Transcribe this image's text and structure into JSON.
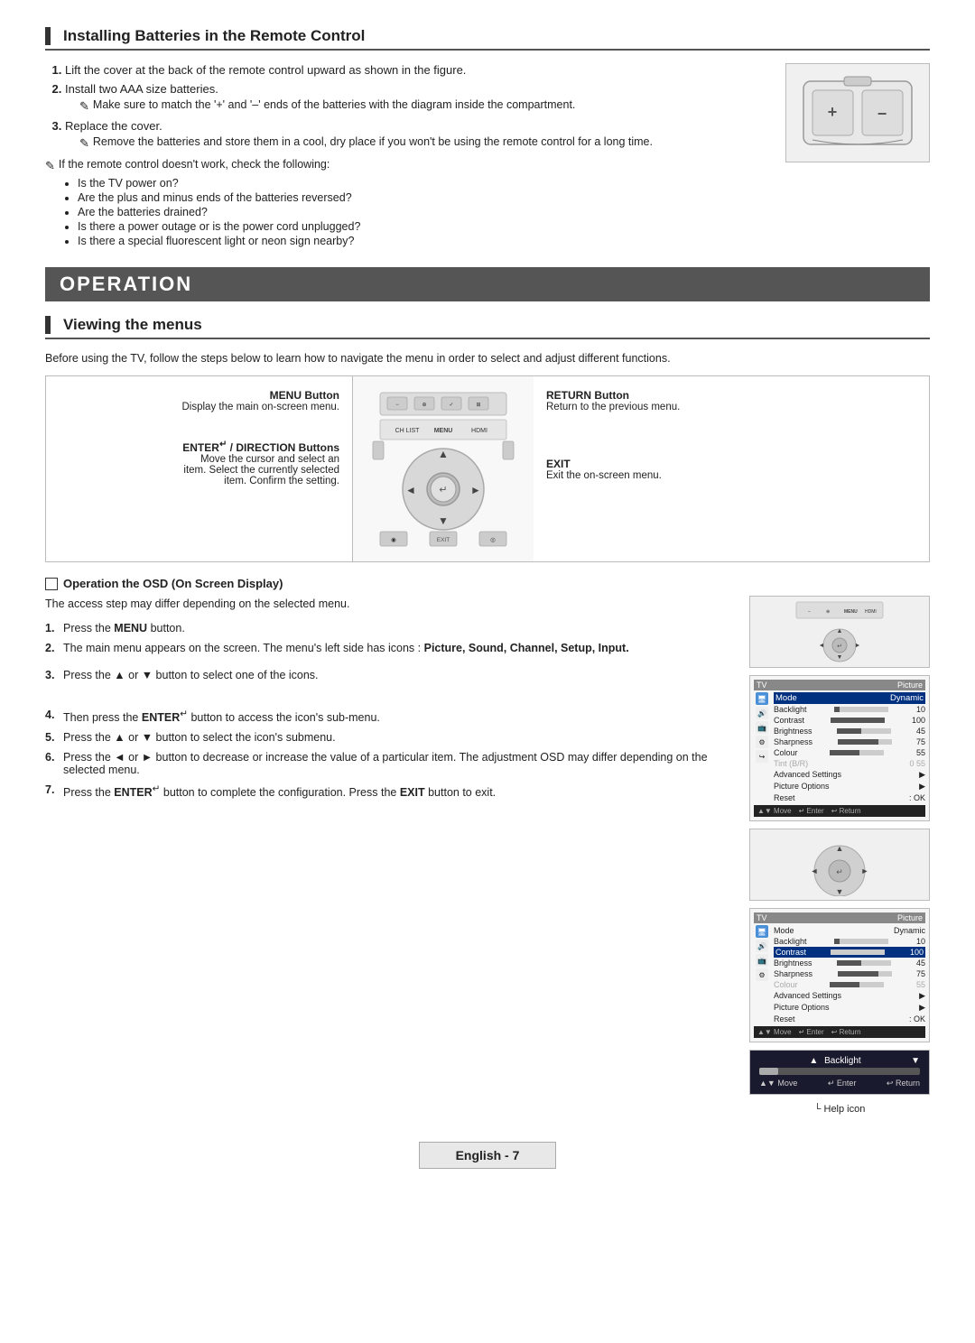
{
  "batteries_section": {
    "title": "Installing Batteries in the Remote Control",
    "steps": [
      {
        "num": "1.",
        "text": "Lift the cover at the back of the remote control upward as shown in the figure."
      },
      {
        "num": "2.",
        "text": "Install two AAA size batteries.",
        "note": "Make sure to match the '+' and '–' ends of the batteries with the diagram inside the compartment."
      },
      {
        "num": "3.",
        "text": "Replace the cover.",
        "note": "Remove the batteries and store them in a cool, dry place if you won't be using the remote control for a long time."
      }
    ],
    "note_heading": "If the remote control doesn't work, check the following:",
    "checklist": [
      "Is the TV power on?",
      "Are the plus and minus ends of the batteries reversed?",
      "Are the batteries drained?",
      "Is there a power outage or is the power cord unplugged?",
      "Is there a special fluorescent light or neon sign nearby?"
    ]
  },
  "operation_header": "OPERATION",
  "viewing_section": {
    "title": "Viewing the menus",
    "intro": "Before using the TV, follow the steps below to learn how to navigate the menu in order to select and adjust different functions.",
    "diagram_labels": {
      "menu_button": "MENU Button",
      "menu_desc": "Display the main on-screen menu.",
      "enter_button": "ENTER / DIRECTION Buttons",
      "enter_desc_1": "Move the cursor and select an",
      "enter_desc_2": "item. Select the currently selected",
      "enter_desc_3": "item. Confirm the setting.",
      "return_button": "RETURN Button",
      "return_desc": "Return to the previous menu.",
      "exit_label": "EXIT",
      "exit_desc": "Exit the on-screen menu."
    }
  },
  "osd_section": {
    "header": "Operation the OSD (On Screen Display)",
    "access_note": "The access step may differ depending on the selected menu.",
    "step1_num": "1.",
    "step1_text": "Press the ",
    "step1_bold": "MENU",
    "step1_suffix": " button.",
    "step2_num": "2.",
    "step2_text": "The main menu appears on the screen. The menu's left side has icons : ",
    "step2_bold": "Picture, Sound, Channel, Setup, Input.",
    "step3_num": "3.",
    "step3_text": "Press the ▲ or ▼ button to select one of the icons.",
    "step4_num": "4.",
    "step4_text": "Then press the ",
    "step4_bold": "ENTER",
    "step4_suffix": " button to access the icon's sub-menu.",
    "step5_num": "5.",
    "step5_text": "Press the ▲ or ▼ button to select the icon's submenu.",
    "step6_num": "6.",
    "step6_text": "Press the ◄ or ► button to decrease or increase the value of a particular item. The adjustment OSD may differ depending on the selected menu.",
    "step7_num": "7.",
    "step7_text": "Press the ",
    "step7_bold": "ENTER",
    "step7_suffix": " button to complete the configuration. Press the ",
    "step7_bold2": "EXIT",
    "step7_suffix2": " button to exit.",
    "menu_items": [
      {
        "label": "Mode",
        "value": "Dynamic",
        "highlighted": true
      },
      {
        "label": "Backlight",
        "value": "10",
        "bar": 10
      },
      {
        "label": "Contrast",
        "value": "100",
        "bar": 100
      },
      {
        "label": "Brightness",
        "value": "45",
        "bar": 45
      },
      {
        "label": "Sharpness",
        "value": "75",
        "bar": 75
      },
      {
        "label": "Colour",
        "value": "55",
        "bar": 55
      }
    ],
    "extra_items": [
      "Tint (B/R)",
      "Advanced Settings",
      "Picture Options",
      "Reset"
    ],
    "help_icon_label": "Help icon",
    "backlight_label": "Backlight",
    "backlight_value": "10",
    "nav_hints": {
      "move": "▲▼ Move",
      "enter": "↵ Enter",
      "return": "↩ Return"
    }
  },
  "footer": {
    "label": "English - 7"
  }
}
